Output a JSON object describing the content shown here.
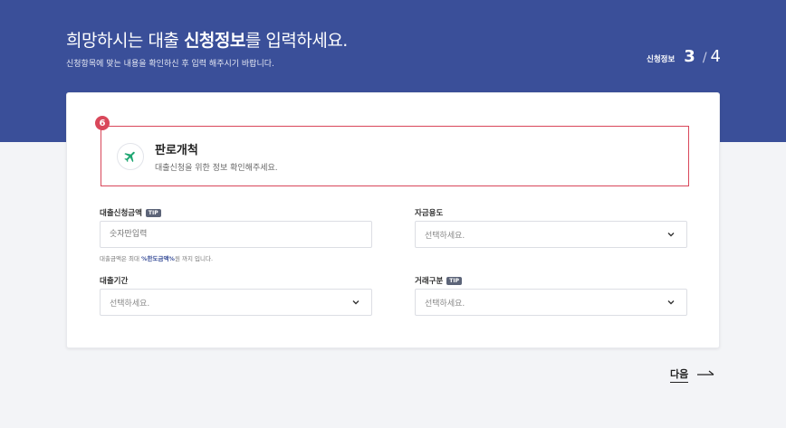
{
  "header": {
    "title_prefix": "희망하시는 대출 ",
    "title_bold": "신청정보",
    "title_suffix": "를 입력하세요.",
    "subtitle": "신청항목에 맞는 내용을 확인하신 후 입력 해주시기 바랍니다.",
    "step_label": "신청정보",
    "step_current": "3",
    "step_separator": "/",
    "step_total": "4"
  },
  "category": {
    "badge": "6",
    "title": "판로개척",
    "description": "대출신청을 위한 정보 확인해주세요.",
    "icon": "airplane-icon",
    "icon_color": "#1fa672"
  },
  "form": {
    "loan_amount": {
      "label": "대출신청금액",
      "tip": "TIP",
      "placeholder": "숫자만입력",
      "help_prefix": "대출금액은 최대 ",
      "help_highlight": "%한도금액%",
      "help_suffix": "원 까지 입니다."
    },
    "fund_purpose": {
      "label": "자금용도",
      "value": "선택하세요."
    },
    "loan_period": {
      "label": "대출기간",
      "value": "선택하세요."
    },
    "transaction_type": {
      "label": "거래구분",
      "tip": "TIP",
      "value": "선택하세요."
    }
  },
  "navigation": {
    "next_label": "다음"
  },
  "colors": {
    "brand": "#3a4f99",
    "highlight_border": "#d9475a"
  }
}
